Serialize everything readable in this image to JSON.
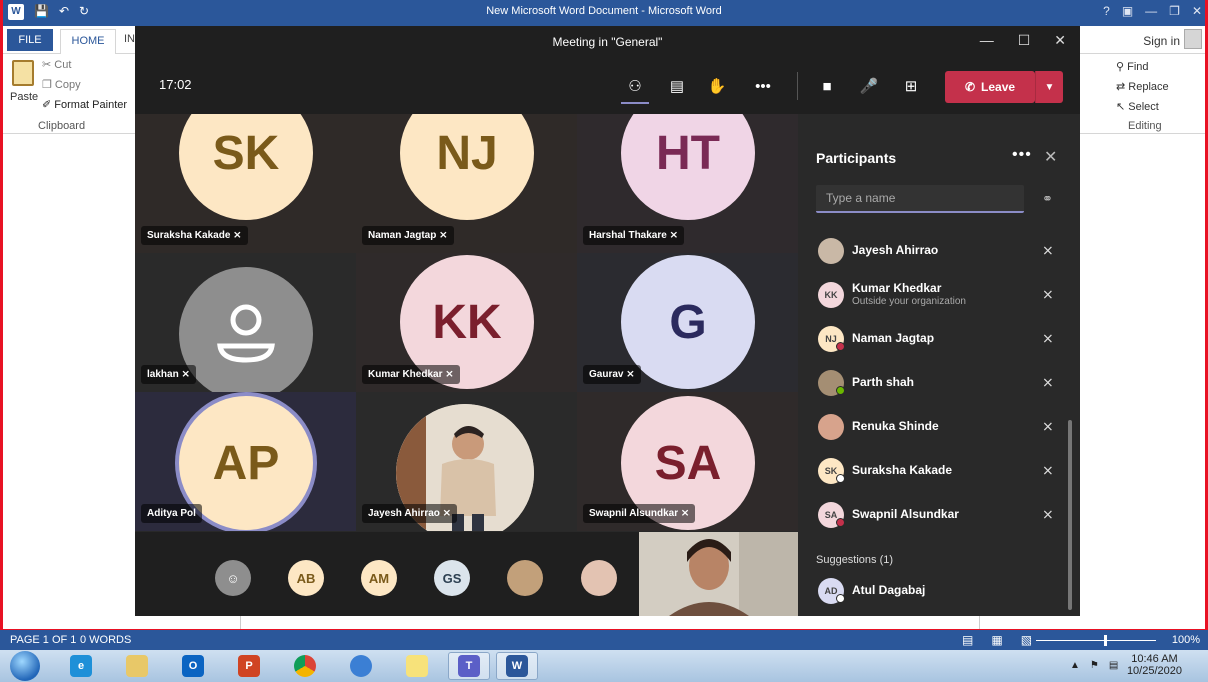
{
  "word": {
    "title": "New Microsoft Word Document - Microsoft Word",
    "tabs": {
      "file": "FILE",
      "home": "HOME",
      "insert": "IN"
    },
    "sign_in": "Sign in",
    "clipboard": {
      "paste": "Paste",
      "cut": "Cut",
      "copy": "Copy",
      "format_painter": "Format Painter",
      "group": "Clipboard"
    },
    "editing": {
      "find": "Find",
      "replace": "Replace",
      "select": "Select",
      "group": "Editing"
    },
    "status": {
      "page": "PAGE 1 OF 1",
      "words": "0 WORDS",
      "zoom": "100%"
    }
  },
  "teams": {
    "window_title": "Meeting in \"General\"",
    "timer": "17:02",
    "leave_label": "Leave",
    "tiles": [
      {
        "initials": "SK",
        "name": "Suraksha Kakade",
        "bg": "#fde7c4",
        "fg": "#7a5a1a"
      },
      {
        "initials": "NJ",
        "name": "Naman Jagtap",
        "bg": "#fde7c4",
        "fg": "#7a5a1a"
      },
      {
        "initials": "HT",
        "name": "Harshal Thakare",
        "bg": "#f0d5e6",
        "fg": "#7a2a55"
      },
      {
        "initials": "",
        "name": "lakhan",
        "bg": "#8e8e8e",
        "fg": "#ffffff"
      },
      {
        "initials": "KK",
        "name": "Kumar Khedkar",
        "bg": "#f3d7dc",
        "fg": "#7a1f2d"
      },
      {
        "initials": "G",
        "name": "Gaurav",
        "bg": "#d9dbf2",
        "fg": "#2b2a5e"
      },
      {
        "initials": "AP",
        "name": "Aditya Pol",
        "bg": "#fde7c4",
        "fg": "#7a5a1a"
      },
      {
        "initials": "",
        "name": "Jayesh Ahirrao",
        "bg": "#e9e2d6",
        "fg": "#333333"
      },
      {
        "initials": "SA",
        "name": "Swapnil Alsundkar",
        "bg": "#f3d7dc",
        "fg": "#7a1f2d"
      }
    ],
    "strip": [
      {
        "initials": "",
        "bg": "#8e8e8e"
      },
      {
        "initials": "AB",
        "bg": "#fde7c4"
      },
      {
        "initials": "AM",
        "bg": "#fde7c4"
      },
      {
        "initials": "GS",
        "bg": "#dbe4ec"
      },
      {
        "initials": "",
        "bg": "#c2a07a"
      },
      {
        "initials": "",
        "bg": "#e3c3b2"
      }
    ],
    "participants_panel": {
      "title": "Participants",
      "search_placeholder": "Type a name",
      "participants": [
        {
          "initials": "",
          "name": "Jayesh Ahirrao",
          "subtitle": "",
          "avatar_bg": "#c9b8a6",
          "status": ""
        },
        {
          "initials": "KK",
          "name": "Kumar Khedkar",
          "subtitle": "Outside your organization",
          "avatar_bg": "#f3d7dc",
          "status": ""
        },
        {
          "initials": "NJ",
          "name": "Naman Jagtap",
          "subtitle": "",
          "avatar_bg": "#fde7c4",
          "status": "#c4314b"
        },
        {
          "initials": "",
          "name": "Parth shah",
          "subtitle": "",
          "avatar_bg": "#a48e73",
          "status": "#6bb700"
        },
        {
          "initials": "",
          "name": "Renuka Shinde",
          "subtitle": "",
          "avatar_bg": "#d7a38c",
          "status": ""
        },
        {
          "initials": "SK",
          "name": "Suraksha Kakade",
          "subtitle": "",
          "avatar_bg": "#fde7c4",
          "status": "#ffffff"
        },
        {
          "initials": "SA",
          "name": "Swapnil Alsundkar",
          "subtitle": "",
          "avatar_bg": "#f3d7dc",
          "status": "#c4314b"
        }
      ],
      "suggestions_label": "Suggestions (1)",
      "suggestions": [
        {
          "initials": "AD",
          "name": "Atul Dagabaj",
          "avatar_bg": "#d9dbf2",
          "status": "#ffffff"
        }
      ]
    }
  },
  "taskbar": {
    "time": "10:46 AM",
    "date": "10/25/2020"
  }
}
